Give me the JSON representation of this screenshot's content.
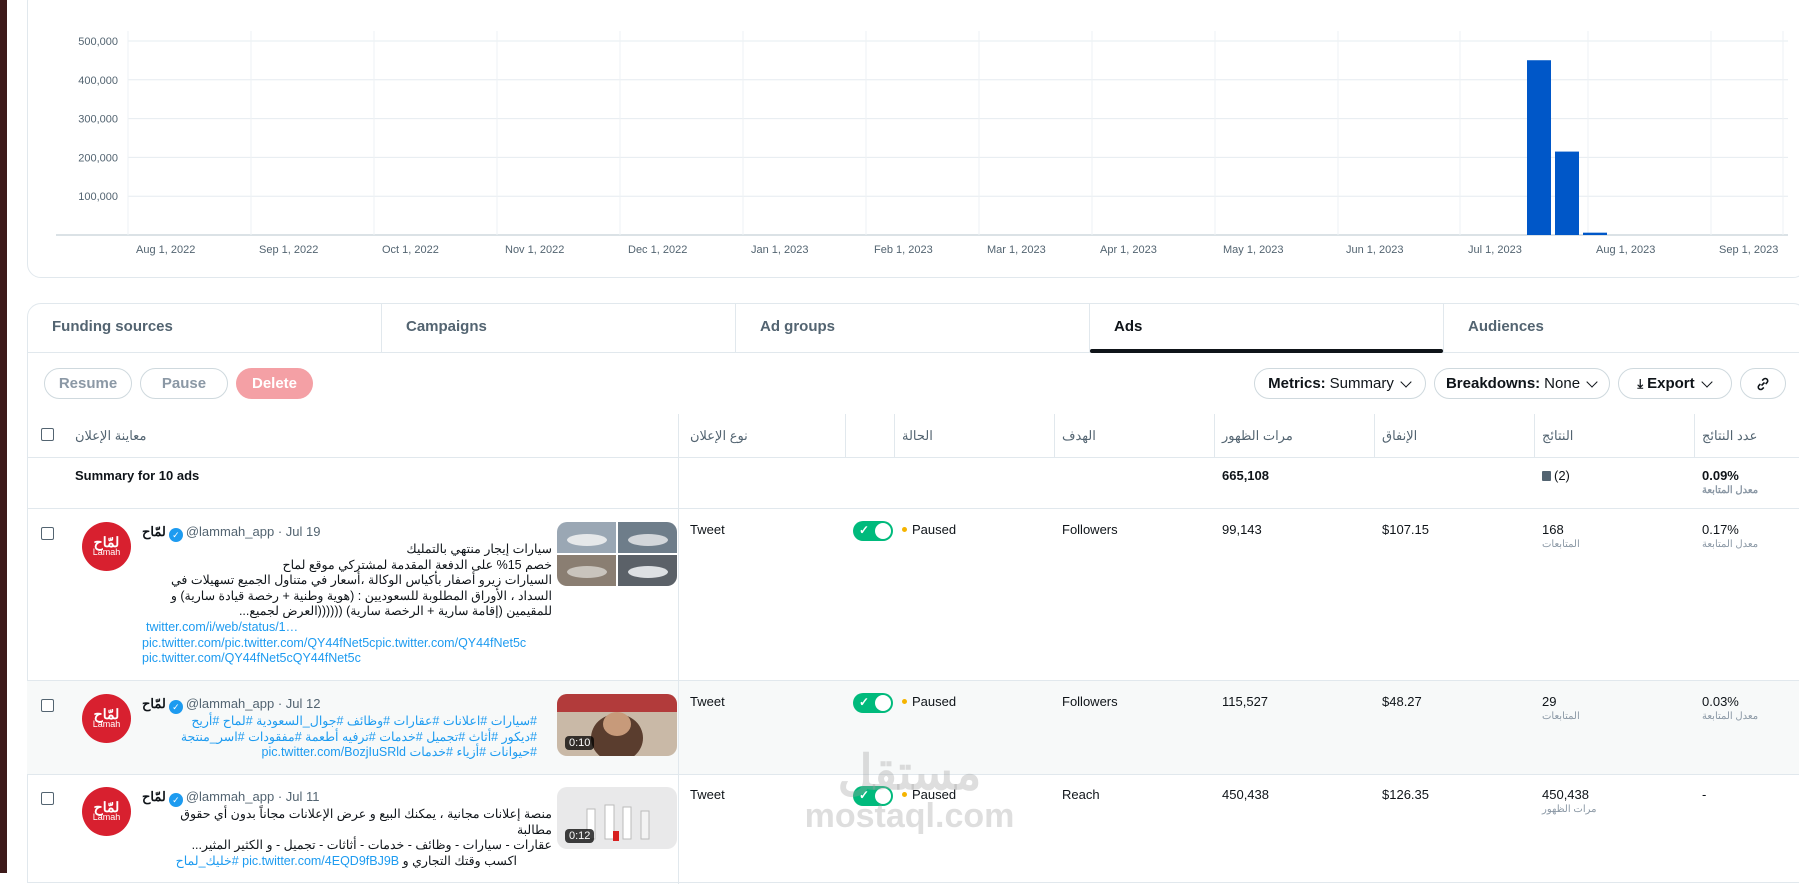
{
  "colors": {
    "accent": "#0057c8",
    "toggle_on": "#00ba7c",
    "paused_dot": "#f5b400",
    "delete_pill": "#f4a0a5",
    "link": "#1d9bf0"
  },
  "chart_data": {
    "type": "bar",
    "title": "",
    "xlabel": "",
    "ylabel": "",
    "ylim": [
      0,
      500000
    ],
    "y_ticks": [
      "500,000",
      "400,000",
      "300,000",
      "200,000",
      "100,000"
    ],
    "x_ticks": [
      "Aug 1, 2022",
      "Sep 1, 2022",
      "Oct 1, 2022",
      "Nov 1, 2022",
      "Dec 1, 2022",
      "Jan 1, 2023",
      "Feb 1, 2023",
      "Mar 1, 2023",
      "Apr 1, 2023",
      "May 1, 2023",
      "Jun 1, 2023",
      "Jul 1, 2023",
      "Aug 1, 2023",
      "Sep 1, 2023"
    ],
    "grid": true,
    "bars": [
      {
        "week_index": 0,
        "value": 450438
      },
      {
        "week_index": 1,
        "value": 215000
      },
      {
        "week_index": 2,
        "value": 6000
      }
    ]
  },
  "tabs": [
    "Funding sources",
    "Campaigns",
    "Ad groups",
    "Ads",
    "Audiences"
  ],
  "active_tab": "Ads",
  "toolbar": {
    "resume": "Resume",
    "pause": "Pause",
    "delete": "Delete",
    "metrics_label": "Metrics:",
    "metrics_value": "Summary",
    "breakdowns_label": "Breakdowns:",
    "breakdowns_value": "None",
    "export": "Export",
    "link_icon": "link-icon"
  },
  "table": {
    "headers": {
      "preview": "معاينة الإعلان",
      "type": "نوع الإعلان",
      "status": "الحالة",
      "objective": "الهدف",
      "impressions": "مرات الظهور",
      "spend": "الإنفاق",
      "results": "النتائج",
      "result_rate": "عدد النتائج"
    },
    "summary": {
      "label": "Summary for 10 ads",
      "impressions": "665,108",
      "results": "(2)",
      "rate": "0.09%",
      "rate_sub": "معدل المتابعة"
    },
    "rows": [
      {
        "name": "لمّاح",
        "handle": "@lammah_app",
        "date": "· Jul 19",
        "text_lines": [
          "سيارات إيجار منتهي بالتمليك",
          "خصم 15% على الدفعة المقدمة لمشتركي موقع لماح",
          "السيارات زيرو أصفار بأكياس الوكالة ،أسعار في متناول الجميع  تسهيلات في",
          "السداد ، الأوراق المطلوبة للسعوديين : (هوية وطنية + رخصة قيادة سارية) و",
          "للمقيمين (إقامة سارية + الرخصة سارية) ((((((العرض لجميع..."
        ],
        "links": [
          "twitter.com/i/web/status/1…",
          "pic.twitter.com/pic.twitter.com/QY44fNet5cpic.twitter.com/QY44fNet5c",
          "pic.twitter.com/QY44fNet5cQY44fNet5c"
        ],
        "type": "Tweet",
        "status": "Paused",
        "objective": "Followers",
        "impressions": "99,143",
        "spend": "$107.15",
        "results": "168",
        "results_sub": "المتابعات",
        "rate": "0.17%",
        "rate_sub": "معدل المتابعة"
      },
      {
        "name": "لمّاح",
        "handle": "@lammah_app",
        "date": "· Jul 12",
        "text_lines": [],
        "links": [
          "#سيارات #اعلانات #عقارات #وظائف #جوال_السعودية #لماح #أريح",
          "#ديكور #أثاث #تجميل #خدمات #ترفيه أطعمة #مفقودات #اسر_منتجة",
          "#حيوانات #أزياء #خدمات pic.twitter.com/BozjIuSRld"
        ],
        "duration": "0:10",
        "type": "Tweet",
        "status": "Paused",
        "objective": "Followers",
        "impressions": "115,527",
        "spend": "$48.27",
        "results": "29",
        "results_sub": "المتابعات",
        "rate": "0.03%",
        "rate_sub": "معدل المتابعة"
      },
      {
        "name": "لمّاح",
        "handle": "@lammah_app",
        "date": "· Jul 11",
        "text_lines": [
          "منصة إعلانات مجانية ، يمكنك البيع و عرض الإعلانات مجاناً بدون أي حقوق",
          "مطالبة",
          "عقارات - سيارات - وظائف - خدمات - أثاثات - تجميل - و الكثير المثير..."
        ],
        "links": [
          "pic.twitter.com/4EQD9fBJ9B #خليك_لماح"
        ],
        "trailing_text": "اكسب وقتك التجاري و",
        "duration": "0:12",
        "type": "Tweet",
        "status": "Paused",
        "objective": "Reach",
        "impressions": "450,438",
        "spend": "$126.35",
        "results": "450,438",
        "results_sub": "مرات الظهور",
        "rate": "-"
      }
    ]
  },
  "avatar": {
    "logo_text": "لمّاح",
    "logo_sub": "Lamah"
  },
  "watermark": {
    "ar": "مستقل",
    "en": "mostaql.com"
  }
}
